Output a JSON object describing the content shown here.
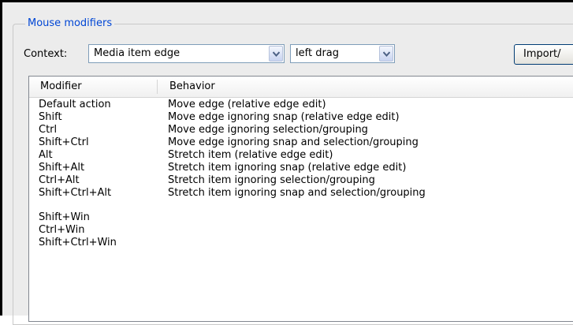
{
  "group": {
    "title": "Mouse modifiers"
  },
  "context": {
    "label": "Context:",
    "combo1_value": "Media item edge",
    "combo2_value": "left drag",
    "import_label": "Import/"
  },
  "list": {
    "headers": [
      "Modifier",
      "Behavior"
    ],
    "rows": [
      {
        "modifier": "Default action",
        "behavior": "Move edge (relative edge edit)"
      },
      {
        "modifier": "Shift",
        "behavior": "Move edge ignoring snap (relative edge edit)"
      },
      {
        "modifier": "Ctrl",
        "behavior": "Move edge ignoring selection/grouping"
      },
      {
        "modifier": "Shift+Ctrl",
        "behavior": "Move edge ignoring snap and selection/grouping"
      },
      {
        "modifier": "Alt",
        "behavior": "Stretch item (relative edge edit)"
      },
      {
        "modifier": "Shift+Alt",
        "behavior": "Stretch item ignoring snap (relative edge edit)"
      },
      {
        "modifier": "Ctrl+Alt",
        "behavior": "Stretch item ignoring selection/grouping"
      },
      {
        "modifier": "Shift+Ctrl+Alt",
        "behavior": "Stretch item ignoring snap and selection/grouping"
      },
      {
        "modifier": "",
        "behavior": ""
      },
      {
        "modifier": "Shift+Win",
        "behavior": ""
      },
      {
        "modifier": "Ctrl+Win",
        "behavior": ""
      },
      {
        "modifier": "Shift+Ctrl+Win",
        "behavior": ""
      }
    ]
  }
}
